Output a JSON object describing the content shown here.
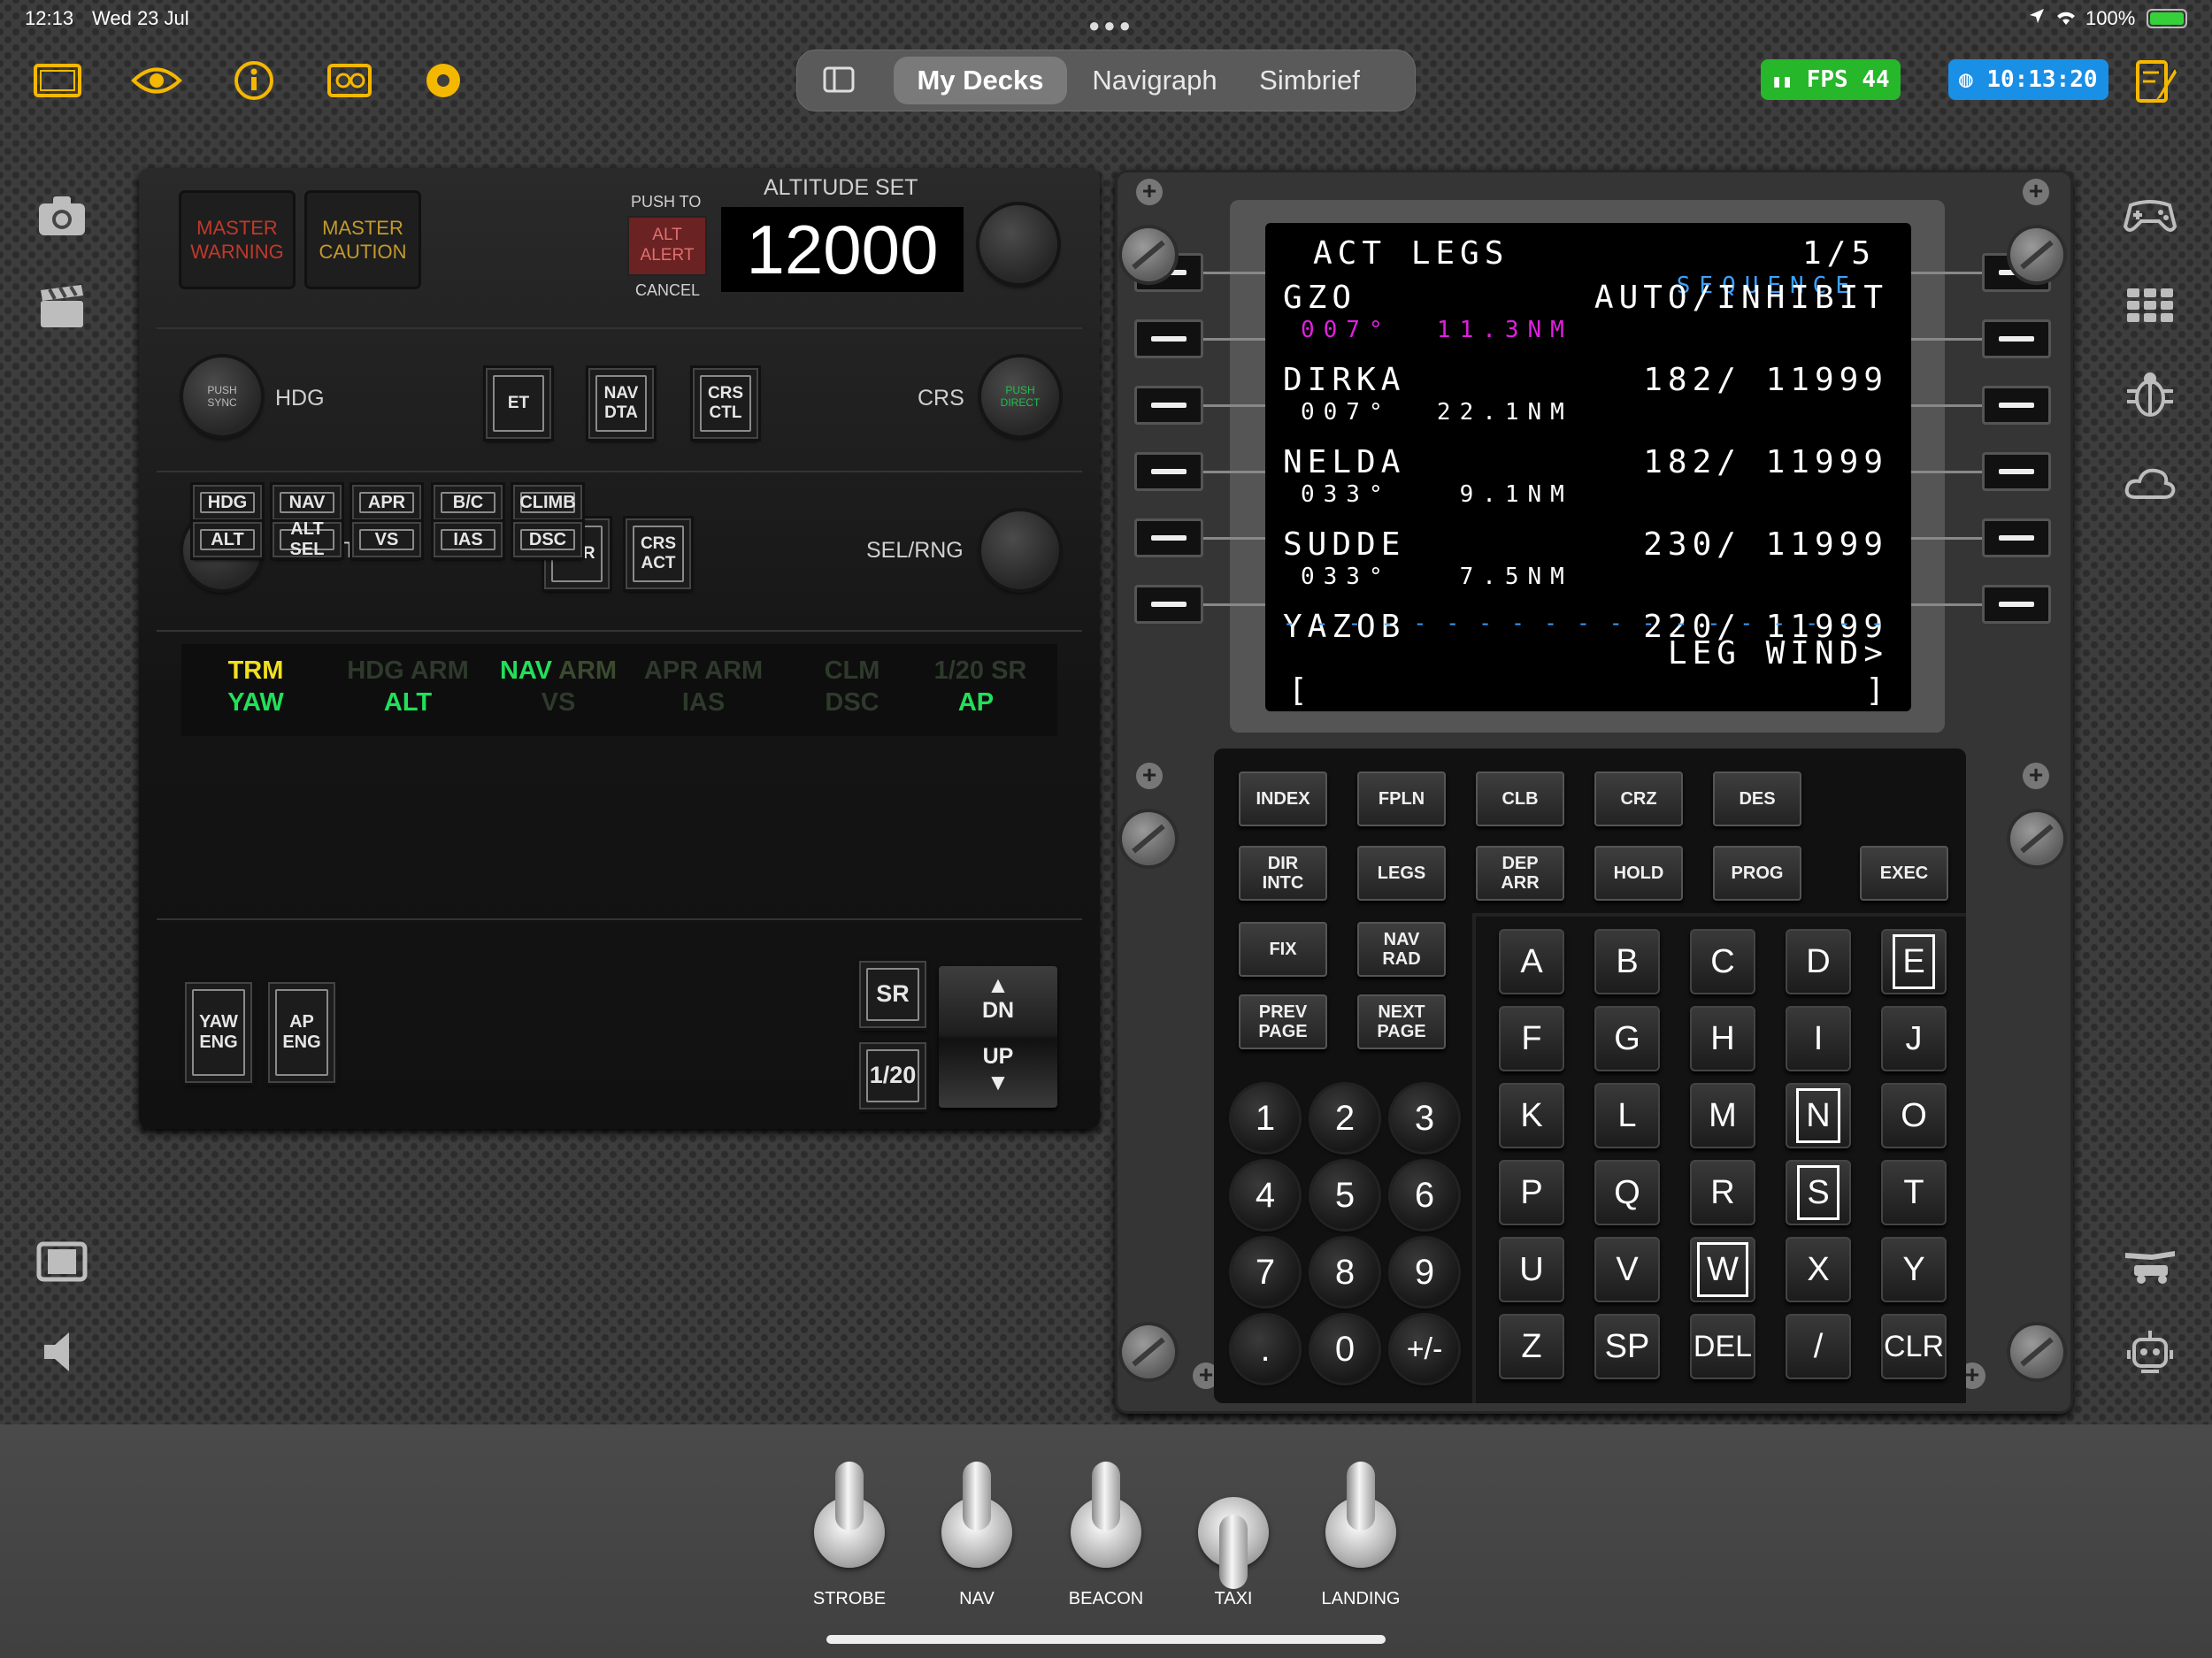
{
  "status": {
    "time": "12:13",
    "date": "Wed 23 Jul",
    "battery": "100%"
  },
  "top_icons": [
    "screen-frame-icon",
    "eye-icon",
    "info-icon",
    "dashboard-icon",
    "record-icon"
  ],
  "tabs": [
    {
      "label": "My Decks",
      "selected": true
    },
    {
      "label": "Navigraph",
      "selected": false
    },
    {
      "label": "Simbrief",
      "selected": false
    }
  ],
  "fps": "FPS 44",
  "clock": "10:13:20",
  "colors": {
    "accent": "#f5b800",
    "fps_bg": "#26b72a",
    "clock_bg": "#1a8fe6",
    "fmc_magenta": "#e020e0",
    "fmc_cyan": "#3aa0ff"
  },
  "left_icons": [
    "camera-icon",
    "clapperboard-icon",
    "film-icon",
    "speaker-icon"
  ],
  "right_icons": [
    "gamepad-icon",
    "grid-icon",
    "bug-icon",
    "cloud-icon",
    "tug-icon",
    "robot-icon"
  ],
  "mcp": {
    "master_warning": "MASTER\nWARNING",
    "master_caution": "MASTER\nCAUTION",
    "push_to": "PUSH TO",
    "alt_alert": "ALT\nALERT",
    "cancel": "CANCEL",
    "altitude_set_label": "ALTITUDE SET",
    "altitude_value": "12000",
    "push_sync": "PUSH\nSYNC",
    "hdg": "HDG",
    "et": "ET",
    "nav_dta": "NAV\nDTA",
    "crs_ctl": "CRS\nCTL",
    "crs": "CRS",
    "push_direct": "PUSH\nDIRECT",
    "dh_set": "DH SET",
    "rdr": "RDR",
    "crs_act": "CRS\nACT",
    "sel_rng": "SEL/RNG",
    "annunciators": [
      {
        "top": "TRM",
        "bottom": "YAW",
        "top_state": "yellow",
        "bottom_state": "on"
      },
      {
        "top": "HDG ARM",
        "bottom": "ALT",
        "top_state": "off",
        "bottom_state": "on"
      },
      {
        "top": "NAV ARM",
        "bottom": "VS",
        "top_state": "on_partial",
        "bottom_state": "off"
      },
      {
        "top": "APR ARM",
        "bottom": "IAS",
        "top_state": "off",
        "bottom_state": "off"
      },
      {
        "top": "CLM",
        "bottom": "DSC",
        "top_state": "off",
        "bottom_state": "off"
      },
      {
        "top": "1/20 SR",
        "bottom": "AP",
        "top_state": "off",
        "bottom_state": "on"
      }
    ],
    "mode_buttons_row1": [
      "HDG",
      "NAV",
      "APR",
      "B/C",
      "CLIMB"
    ],
    "mode_buttons_row2": [
      "ALT",
      "ALT SEL",
      "VS",
      "IAS",
      "DSC"
    ],
    "yaw_eng": "YAW\nENG",
    "ap_eng": "AP\nENG",
    "sr": "SR",
    "one_twenty": "1/20",
    "dn": "DN",
    "up": "UP"
  },
  "fmc": {
    "title": "ACT LEGS",
    "page": "1/5",
    "sequence": "SEQUENCE",
    "lines": [
      {
        "wpt": "GZO",
        "right": "AUTO/INHIBIT",
        "sub": "007°  11.3NM",
        "sub_magenta": true
      },
      {
        "wpt": "DIRKA",
        "right": "182/ 11999",
        "sub": "007°  22.1NM",
        "sub_magenta": false
      },
      {
        "wpt": "NELDA",
        "right": "182/ 11999",
        "sub": "033°   9.1NM",
        "sub_magenta": false
      },
      {
        "wpt": "SUDDE",
        "right": "230/ 11999",
        "sub": "033°   7.5NM",
        "sub_magenta": false
      },
      {
        "wpt": "YAZOB",
        "right": "220/ 11999",
        "sub": "",
        "sub_magenta": false
      }
    ],
    "dashes": "- - - - - - - - - - - - - - - - - - - -",
    "leg_wind": "LEG WIND>",
    "scratch_left": "[",
    "scratch_right": "]",
    "func_row1": [
      "INDEX",
      "FPLN",
      "CLB",
      "CRZ",
      "DES"
    ],
    "func_row2": [
      "DIR\nINTC",
      "LEGS",
      "DEP\nARR",
      "HOLD",
      "PROG"
    ],
    "exec": "EXEC",
    "fix": "FIX",
    "nav_rad": "NAV\nRAD",
    "prev_page": "PREV\nPAGE",
    "next_page": "NEXT\nPAGE",
    "alpha": [
      [
        "A",
        "B",
        "C",
        "D",
        "E"
      ],
      [
        "F",
        "G",
        "H",
        "I",
        "J"
      ],
      [
        "K",
        "L",
        "M",
        "N",
        "O"
      ],
      [
        "P",
        "Q",
        "R",
        "S",
        "T"
      ],
      [
        "U",
        "V",
        "W",
        "X",
        "Y"
      ],
      [
        "Z",
        "SP",
        "DEL",
        "/",
        "CLR"
      ]
    ],
    "numeric": [
      [
        "1",
        "2",
        "3"
      ],
      [
        "4",
        "5",
        "6"
      ],
      [
        "7",
        "8",
        "9"
      ],
      [
        ".",
        "0",
        "+/-"
      ]
    ]
  },
  "switches": [
    {
      "label": "STROBE",
      "on": false
    },
    {
      "label": "NAV",
      "on": false
    },
    {
      "label": "BEACON",
      "on": false
    },
    {
      "label": "TAXI",
      "on": true
    },
    {
      "label": "LANDING",
      "on": false
    }
  ]
}
